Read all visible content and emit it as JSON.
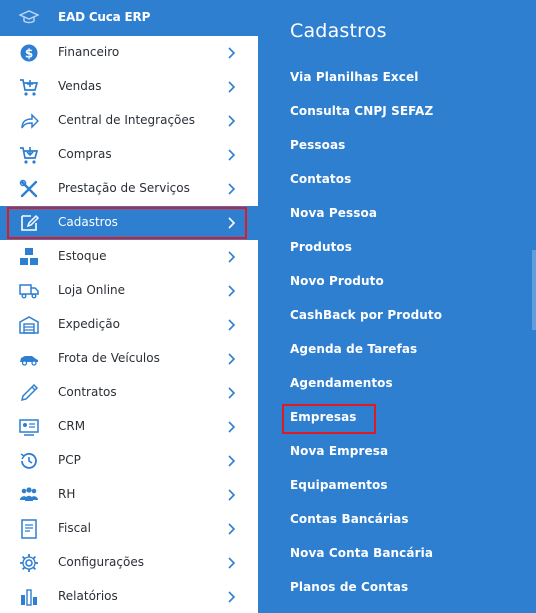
{
  "header": {
    "title": "EAD Cuca ERP",
    "icon": "graduation-cap-icon"
  },
  "colors": {
    "accent": "#2f7fd0",
    "highlight": "#e01a22",
    "icon": "#2f7fd0"
  },
  "sidebar": {
    "items": [
      {
        "label": "Financeiro",
        "icon": "dollar-icon"
      },
      {
        "label": "Vendas",
        "icon": "cart-plus-icon"
      },
      {
        "label": "Central de Integrações",
        "icon": "share-icon"
      },
      {
        "label": "Compras",
        "icon": "cart-down-icon"
      },
      {
        "label": "Prestação de Serviços",
        "icon": "tools-icon"
      },
      {
        "label": "Cadastros",
        "icon": "edit-icon",
        "active": true
      },
      {
        "label": "Estoque",
        "icon": "boxes-icon"
      },
      {
        "label": "Loja Online",
        "icon": "truck-icon"
      },
      {
        "label": "Expedição",
        "icon": "warehouse-icon"
      },
      {
        "label": "Frota de Veículos",
        "icon": "car-icon"
      },
      {
        "label": "Contratos",
        "icon": "pen-icon"
      },
      {
        "label": "CRM",
        "icon": "id-card-icon"
      },
      {
        "label": "PCP",
        "icon": "history-icon"
      },
      {
        "label": "RH",
        "icon": "people-icon"
      },
      {
        "label": "Fiscal",
        "icon": "document-icon"
      },
      {
        "label": "Configurações",
        "icon": "gear-icon"
      },
      {
        "label": "Relatórios",
        "icon": "bar-chart-icon"
      }
    ]
  },
  "panel": {
    "title": "Cadastros",
    "items": [
      "Via Planilhas Excel",
      "Consulta CNPJ SEFAZ",
      "Pessoas",
      "Contatos",
      "Nova Pessoa",
      "Produtos",
      "Novo Produto",
      "CashBack por Produto",
      "Agenda de Tarefas",
      "Agendamentos",
      "Empresas",
      "Nova Empresa",
      "Equipamentos",
      "Contas Bancárias",
      "Nova Conta Bancária",
      "Planos de Contas"
    ],
    "highlighted": "Empresas"
  }
}
